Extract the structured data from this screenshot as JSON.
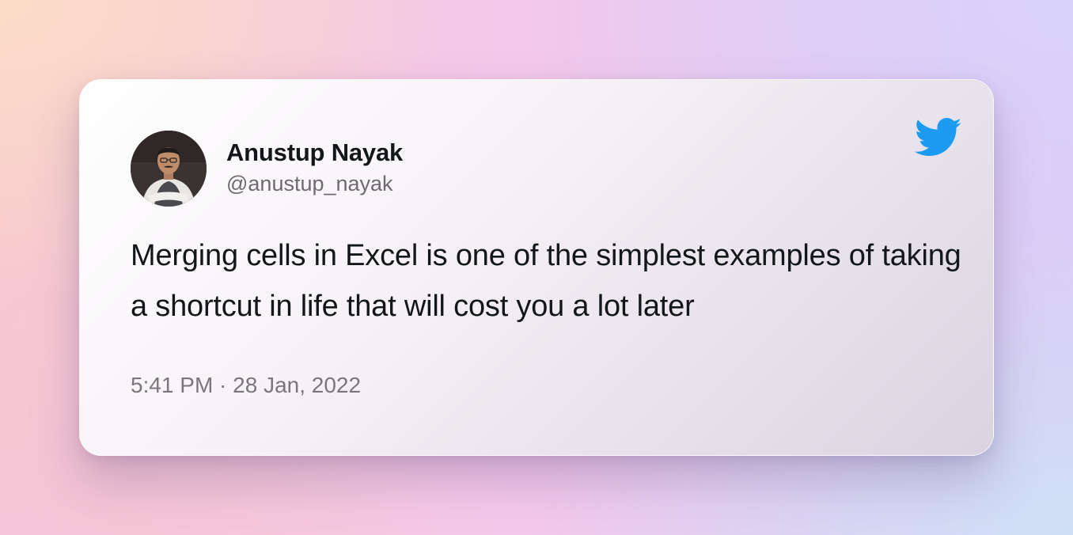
{
  "tweet": {
    "author_name": "Anustup Nayak",
    "author_handle": "@anustup_nayak",
    "text": "Merging cells in Excel is one of the simplest examples of taking a shortcut in life that will cost you a lot later",
    "timestamp": "5:41 PM · 28 Jan, 2022"
  },
  "icons": {
    "brand": "twitter-bird-icon",
    "avatar": "profile-photo"
  },
  "colors": {
    "twitter_blue": "#1d9bf0",
    "text_primary": "#14171a",
    "text_secondary": "#6e6a6e"
  }
}
